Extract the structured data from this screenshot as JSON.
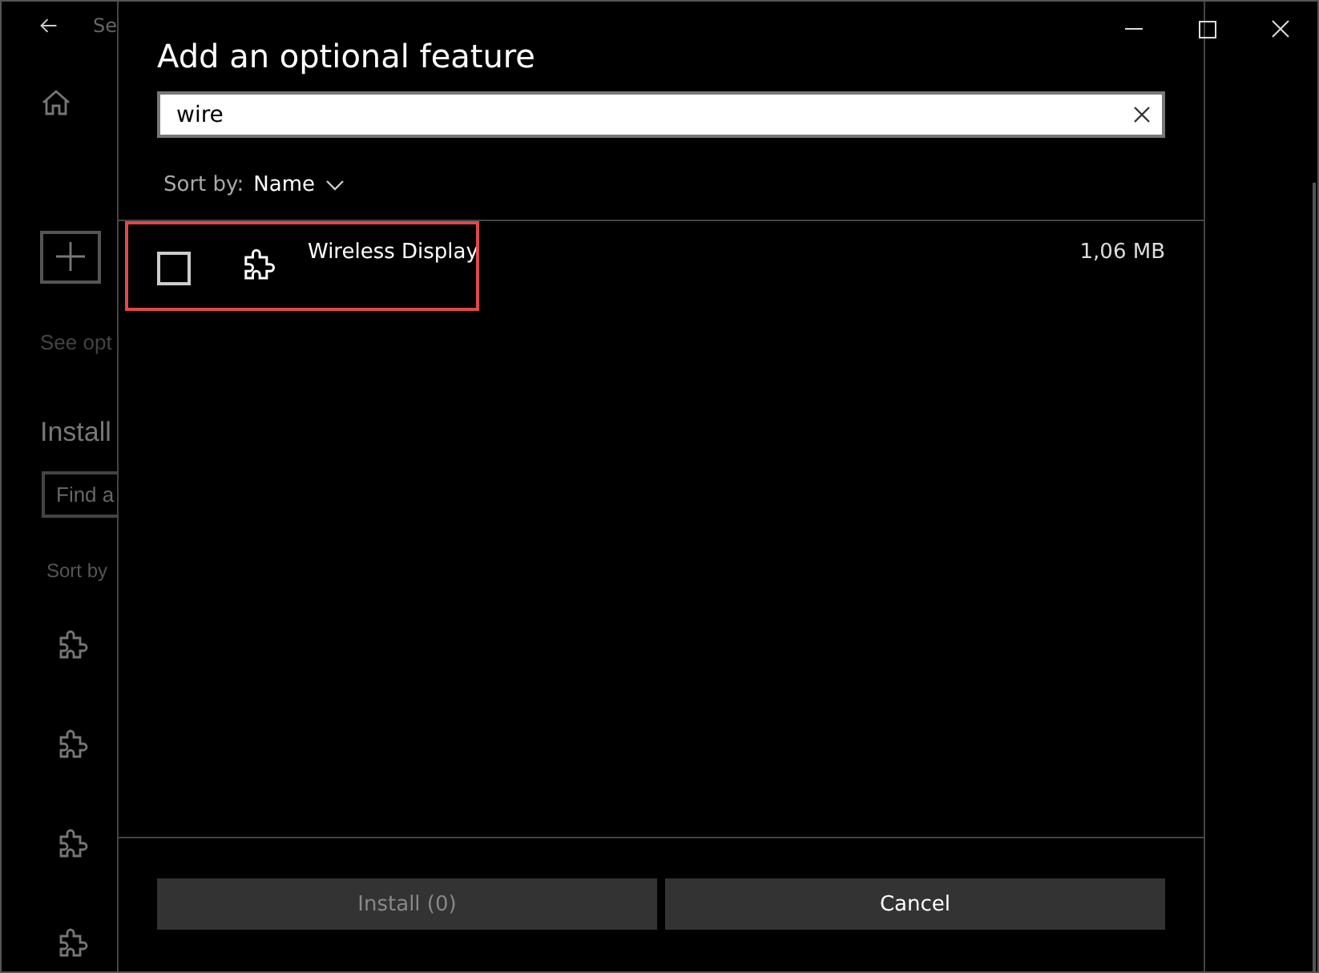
{
  "background_window": {
    "title": "Se",
    "link": "See opt",
    "heading": "Install",
    "search": {
      "placeholder": "Find a"
    },
    "sort_label": "Sort by"
  },
  "dialog": {
    "title": "Add an optional feature",
    "search": {
      "value": "wire"
    },
    "sort": {
      "label": "Sort by:",
      "value": "Name"
    },
    "features": [
      {
        "name": "Wireless Display",
        "size": "1,06 MB",
        "checked": false,
        "highlighted": true
      }
    ],
    "buttons": [
      {
        "label": "Install (0)",
        "disabled": true
      },
      {
        "label": "Cancel",
        "disabled": false
      }
    ]
  }
}
